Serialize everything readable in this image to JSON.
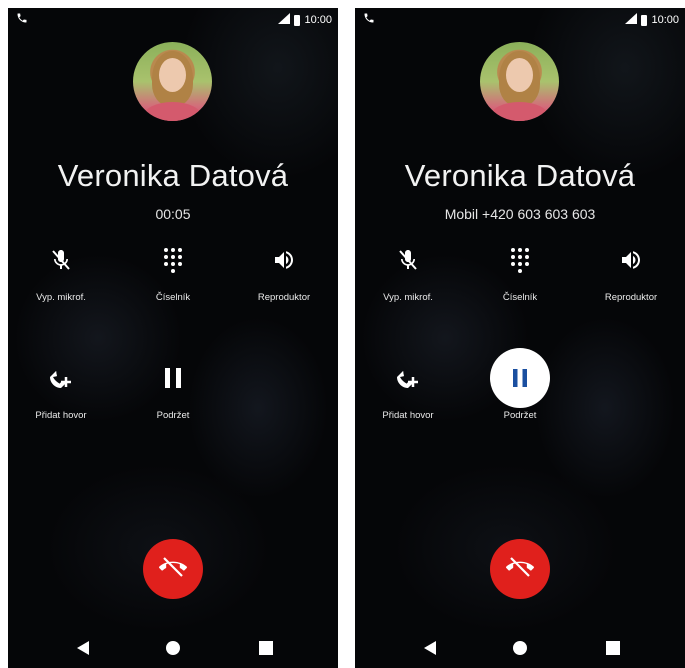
{
  "screens": [
    {
      "status": {
        "time": "10:00"
      },
      "caller_name": "Veronika Datová",
      "call_sub": "00:05",
      "actions": {
        "mute": "Vyp. mikrof.",
        "dialpad": "Číselník",
        "speaker": "Reproduktor",
        "add_call": "Přidat hovor",
        "hold": "Podržet"
      },
      "hold_active": false
    },
    {
      "status": {
        "time": "10:00"
      },
      "caller_name": "Veronika Datová",
      "call_sub": "Mobil +420 603 603 603",
      "actions": {
        "mute": "Vyp. mikrof.",
        "dialpad": "Číselník",
        "speaker": "Reproduktor",
        "add_call": "Přidat hovor",
        "hold": "Podržet"
      },
      "hold_active": true
    }
  ],
  "colors": {
    "end_call": "#e0201c",
    "hold_active_icon": "#1a4fa0",
    "background": "#050608"
  },
  "icons": [
    "phone-call-icon",
    "signal-icon",
    "battery-icon",
    "mic-off-icon",
    "dialpad-icon",
    "speaker-icon",
    "add-call-icon",
    "pause-icon",
    "end-call-icon",
    "back-icon",
    "home-icon",
    "recents-icon"
  ]
}
